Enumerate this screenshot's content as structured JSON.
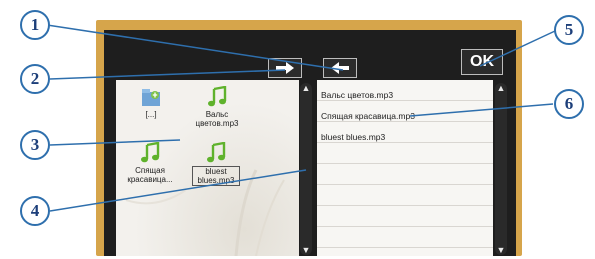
{
  "buttons": {
    "ok_label": "OK"
  },
  "left_pane": {
    "items": [
      {
        "label": "[...]",
        "icon": "folder-up-icon"
      },
      {
        "label": "Вальс цветов.mp3",
        "icon": "music-note-icon"
      },
      {
        "label": "Спящая красавица...",
        "icon": "music-note-icon"
      },
      {
        "label": "bluest blues.mp3",
        "icon": "music-note-icon"
      }
    ]
  },
  "right_pane": {
    "rows": [
      "Вальс цветов.mp3",
      "Спящая красавица.mp3",
      "bluest blues.mp3"
    ]
  },
  "callouts": [
    "1",
    "2",
    "3",
    "4",
    "5",
    "6"
  ],
  "colors": {
    "frame": "#d6a54b",
    "window": "#1e1e1e",
    "callout_border": "#2e6fad",
    "callout_text": "#1d3f7a",
    "note_icon": "#5fb22c"
  }
}
